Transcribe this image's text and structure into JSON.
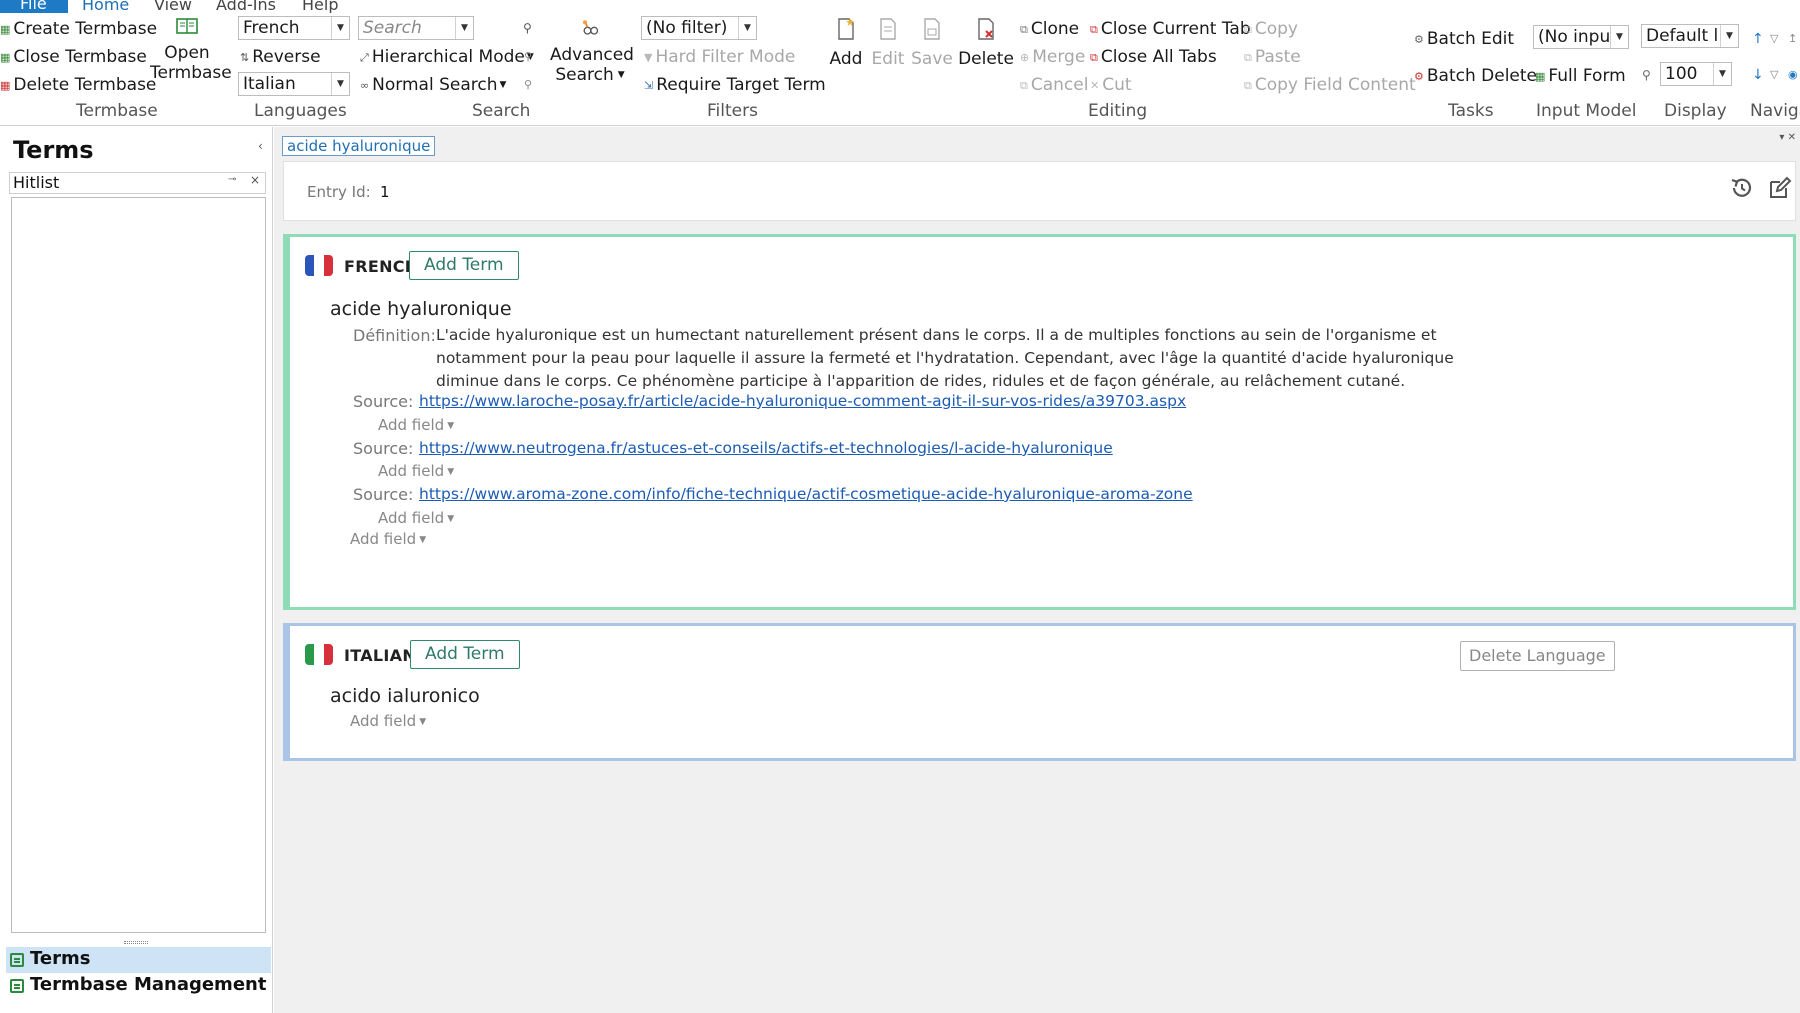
{
  "menu": {
    "file": "File",
    "home": "Home",
    "view": "View",
    "addins": "Add-Ins",
    "help": "Help"
  },
  "ribbon": {
    "termbase": {
      "create": "Create Termbase",
      "close": "Close Termbase",
      "delete": "Delete Termbase",
      "open_line1": "Open",
      "open_line2": "Termbase",
      "group": "Termbase"
    },
    "languages": {
      "source": "French",
      "reverse": "Reverse",
      "target": "Italian",
      "group": "Languages"
    },
    "search": {
      "placeholder": "Search",
      "hierarchical": "Hierarchical Mode",
      "normal": "Normal Search",
      "advanced_line1": "Advanced",
      "advanced_line2": "Search",
      "group": "Search"
    },
    "filters": {
      "filter_value": "(No filter)",
      "hard_filter": "Hard Filter Mode",
      "require_target": "Require Target Term",
      "group": "Filters"
    },
    "editing": {
      "add": "Add",
      "edit": "Edit",
      "save": "Save",
      "delete": "Delete",
      "clone": "Clone",
      "merge": "Merge",
      "cancel": "Cancel",
      "close_current_tab": "Close Current Tab",
      "close_all_tabs": "Close All Tabs",
      "cut": "Cut",
      "copy": "Copy",
      "paste": "Paste",
      "copy_field_content": "Copy Field Content",
      "group": "Editing"
    },
    "tasks": {
      "batch_edit": "Batch Edit",
      "batch_delete": "Batch Delete",
      "group": "Tasks"
    },
    "input_model": {
      "value": "(No inpu",
      "full_form": "Full Form",
      "group": "Input Model"
    },
    "display": {
      "layout": "Default l",
      "zoom": "100",
      "group": "Display"
    },
    "navigation": {
      "group": "Navigation"
    }
  },
  "left_pane": {
    "title": "Terms",
    "hitlist": "Hitlist",
    "nav_terms": "Terms",
    "nav_termbase_management": "Termbase Management"
  },
  "tab": {
    "label": "acide hyaluronique"
  },
  "entry": {
    "id_label": "Entry Id:",
    "id_value": "1"
  },
  "french": {
    "name": "FRENCH",
    "add_term": "Add Term",
    "term": "acide hyaluronique",
    "definition_label": "Définition:",
    "definition": "L'acide hyaluronique est un humectant naturellement présent dans le corps. Il a de multiples fonctions au sein de l'organisme et notamment pour la peau pour laquelle il assure la fermeté et l'hydratation. Cependant, avec l'âge la quantité d'acide hyaluronique diminue dans le corps. Ce phénomène participe à l'apparition de rides, ridules et de façon générale, au relâchement cutané.",
    "source_label": "Source:",
    "sources": [
      "https://www.laroche-posay.fr/article/acide-hyaluronique-comment-agit-il-sur-vos-rides/a39703.aspx",
      "https://www.neutrogena.fr/astuces-et-conseils/actifs-et-technologies/l-acide-hyaluronique",
      "https://www.aroma-zone.com/info/fiche-technique/actif-cosmetique-acide-hyaluronique-aroma-zone"
    ],
    "add_field": "Add field"
  },
  "italian": {
    "name": "ITALIAN",
    "add_term": "Add Term",
    "term": "acido ialuronico",
    "add_field": "Add field",
    "delete_language": "Delete Language"
  },
  "colors": {
    "accent_blue": "#1f7ac6",
    "french_border": "#8fdcb8",
    "italian_border": "#aac4e8",
    "link": "#1c5cb5"
  }
}
